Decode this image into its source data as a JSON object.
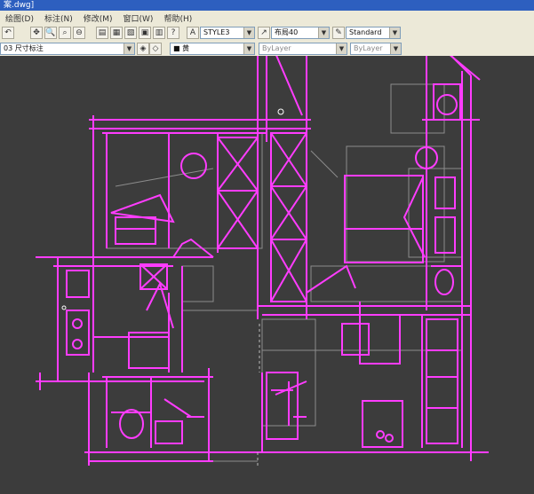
{
  "window": {
    "title": "案.dwg]"
  },
  "menu": [
    {
      "label": "绘图(D)"
    },
    {
      "label": "标注(N)"
    },
    {
      "label": "修改(M)"
    },
    {
      "label": "窗口(W)"
    },
    {
      "label": "帮助(H)"
    }
  ],
  "toolbar1": {
    "text_style_value": "STYLE3",
    "dim_style_value": "布局40",
    "table_style_value": "Standard"
  },
  "toolbar2": {
    "layer_value": "03 尺寸标注",
    "color_value": "■ 黄",
    "linetype_value": "ByLayer",
    "lineweight_value": "ByLayer"
  },
  "colors": {
    "canvas_bg": "#3c3c3c",
    "highlight": "#ff3cff",
    "cad_lines": "#8c8c8c"
  }
}
